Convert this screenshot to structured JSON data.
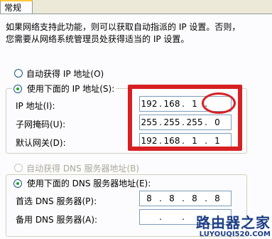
{
  "tab": {
    "label": "常规"
  },
  "description": "如果网络支持此功能，则可以获取自动指派的 IP 设置。否则，\n您需要从网络系统管理员处获得适当的 IP 设置。",
  "ip_section": {
    "auto_label": "自动获得 IP 地址(O)",
    "manual_label": "使用下面的 IP 地址(S):",
    "selected": "manual",
    "fields": {
      "ip_address": {
        "label": "IP 地址(I):",
        "octets": [
          "192",
          "168",
          "1",
          ""
        ]
      },
      "subnet_mask": {
        "label": "子网掩码(U):",
        "octets": [
          "255",
          "255",
          "255",
          "0"
        ]
      },
      "default_gateway": {
        "label": "默认网关(D):",
        "octets": [
          "192",
          "168",
          "1",
          "1"
        ]
      }
    }
  },
  "dns_section": {
    "auto_label": "自动获得 DNS 服务器地址(B)",
    "auto_disabled": true,
    "manual_label": "使用下面的 DNS 服务器地址(E):",
    "selected": "manual",
    "fields": {
      "preferred_dns": {
        "label": "首选 DNS 服务器(P):",
        "octets": [
          "8",
          "8",
          "8",
          "8"
        ]
      },
      "alternate_dns": {
        "label": "备用 DNS 服务器(A):",
        "octets": [
          "",
          "",
          "",
          ""
        ]
      }
    }
  },
  "annotation": {
    "color": "#d81f22"
  },
  "watermark": {
    "title": "路由器之家",
    "url": "LUYOUQI520.COM"
  }
}
